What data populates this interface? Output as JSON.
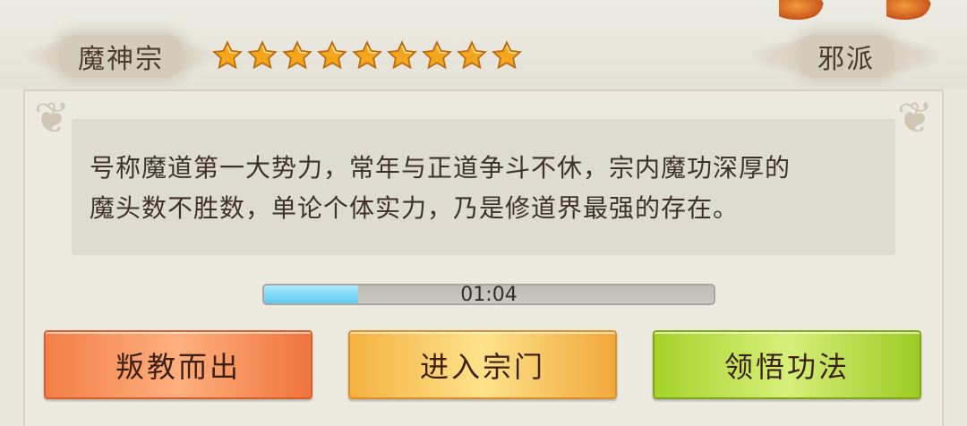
{
  "header": {
    "sect_name": "魔神宗",
    "faction": "邪派",
    "star_rating": 9,
    "star_color": "#f2a51d"
  },
  "description": {
    "line1": "号称魔道第一大势力，常年与正道争斗不休，宗内魔功深厚的",
    "line2": "魔头数不胜数，单论个体实力，乃是修道界最强的存在。"
  },
  "timer": {
    "text": "01:04",
    "progress_fraction": 0.21,
    "fill_color": "#5ec8f0"
  },
  "buttons": {
    "defect_label": "叛教而出",
    "enter_label": "进入宗门",
    "learn_label": "领悟功法"
  }
}
